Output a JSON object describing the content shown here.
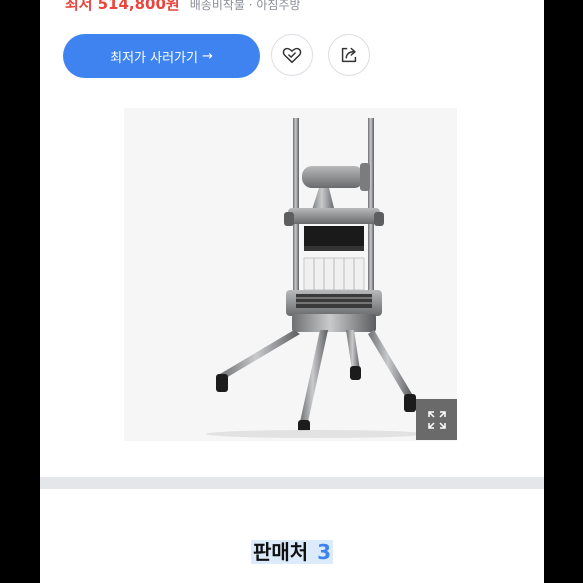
{
  "price": {
    "label": "최저",
    "value": "514,800원",
    "shipping": "배송비착불 · 아침주방"
  },
  "actions": {
    "buy_label": "최저가 사러가기",
    "buy_arrow": "→",
    "like_icon": "heart-check-icon",
    "share_icon": "share-icon"
  },
  "product": {
    "image": "vegetable-dicer-cutter-product-photo",
    "expand_icon": "expand-icon"
  },
  "sellers": {
    "title": "판매처",
    "count": "3"
  },
  "colors": {
    "accent": "#3f83f0",
    "price": "#e8453c",
    "divider": "#e4e6e9"
  }
}
